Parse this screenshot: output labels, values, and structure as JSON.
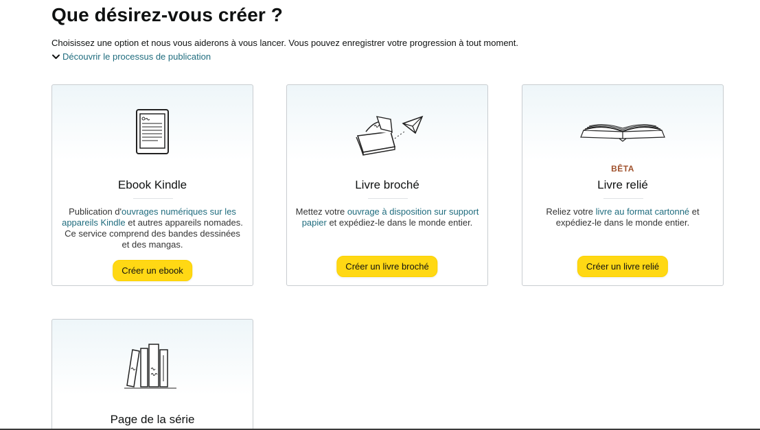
{
  "header": {
    "title": "Que désirez-vous créer ?",
    "subtitle": "Choisissez une option et nous vous aiderons à vous lancer. Vous pouvez enregistrer votre progression à tout moment.",
    "expander_label": "Découvrir le processus de publication"
  },
  "cards": {
    "ebook": {
      "name": "Ebook Kindle",
      "desc_pre": "Publication d'",
      "desc_link": "ouvrages numériques sur les appareils Kindle",
      "desc_post": " et autres appareils nomades. Ce service comprend des bandes dessinées et des mangas.",
      "button": "Créer un ebook",
      "icon": "ereader-icon"
    },
    "paperback": {
      "name": "Livre broché",
      "desc_pre": "Mettez votre ",
      "desc_link": "ouvrage à disposition sur support papier",
      "desc_post": " et expédiez-le dans le monde entier.",
      "button": "Créer un livre broché",
      "icon": "paper-plane-book-icon"
    },
    "hardcover": {
      "badge": "BÊTA",
      "name": "Livre relié",
      "desc_pre": "Reliez votre ",
      "desc_link": "livre au format cartonné",
      "desc_post": " et expédiez-le dans le monde entier.",
      "button": "Créer un livre relié",
      "icon": "open-book-icon"
    },
    "series": {
      "name": "Page de la série",
      "icon": "books-stack-icon"
    }
  },
  "colors": {
    "link": "#1f6c7e",
    "button": "#ffd814",
    "badge": "#a0522d",
    "card_border": "#c8ccd0"
  }
}
